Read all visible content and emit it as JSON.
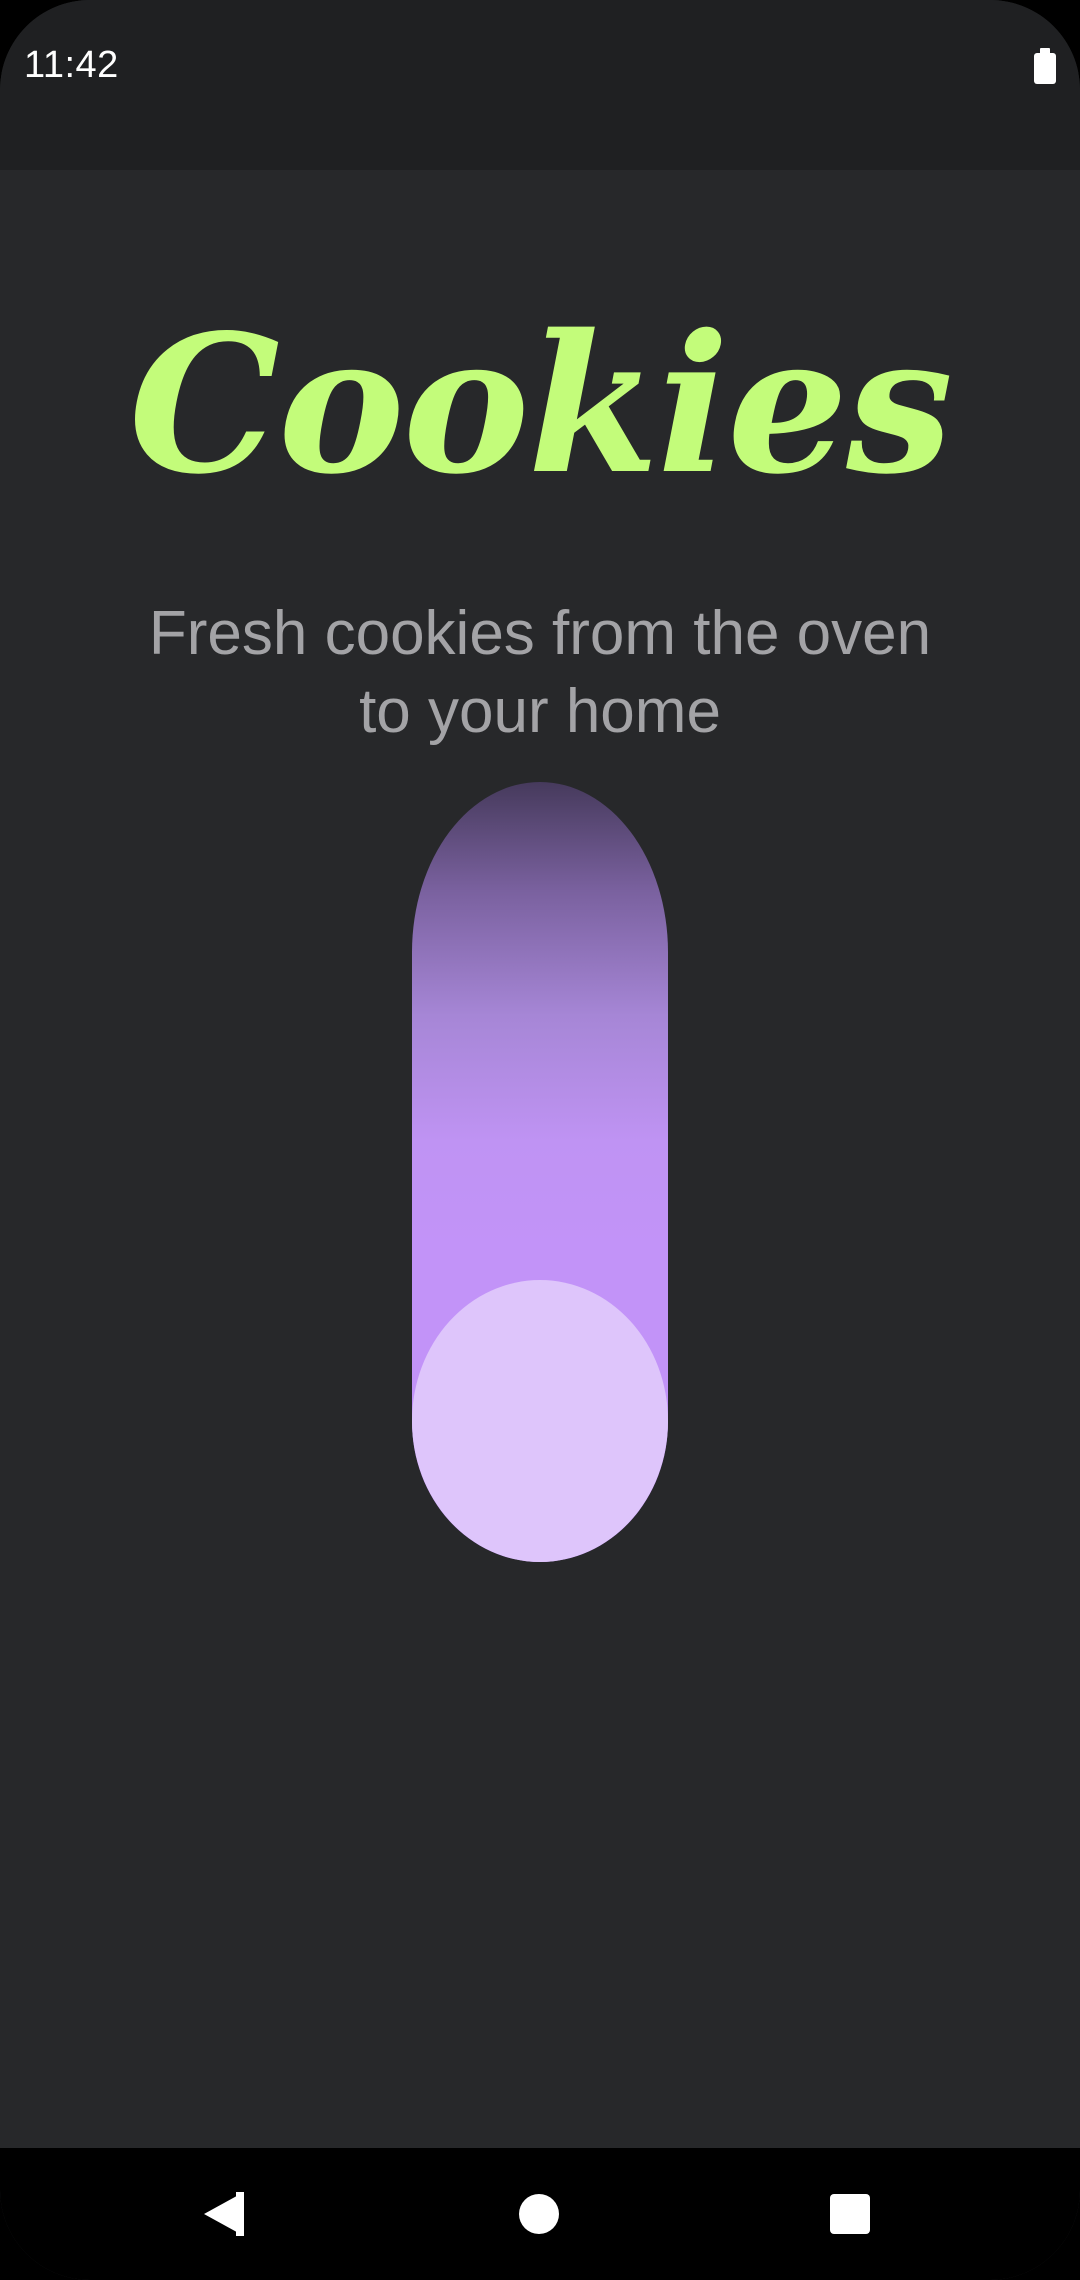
{
  "status_bar": {
    "time": "11:42",
    "battery_icon": "battery-full-icon"
  },
  "main": {
    "title": "Cookies",
    "subtitle": "Fresh cookies from the oven to your home",
    "toggle": {
      "orientation": "vertical",
      "state": "off",
      "thumb_position": "bottom"
    }
  },
  "nav_bar": {
    "back_icon": "back-triangle-icon",
    "home_icon": "home-circle-icon",
    "recents_icon": "recents-square-icon"
  },
  "colors": {
    "background": "#27282a",
    "status_bar": "#1f2022",
    "title": "#c3fc7a",
    "subtitle": "#a3a3a6",
    "track_top": "#463a5c",
    "track_bottom": "#c293f8",
    "thumb": "#dec5fb",
    "nav_bar": "#000000"
  }
}
